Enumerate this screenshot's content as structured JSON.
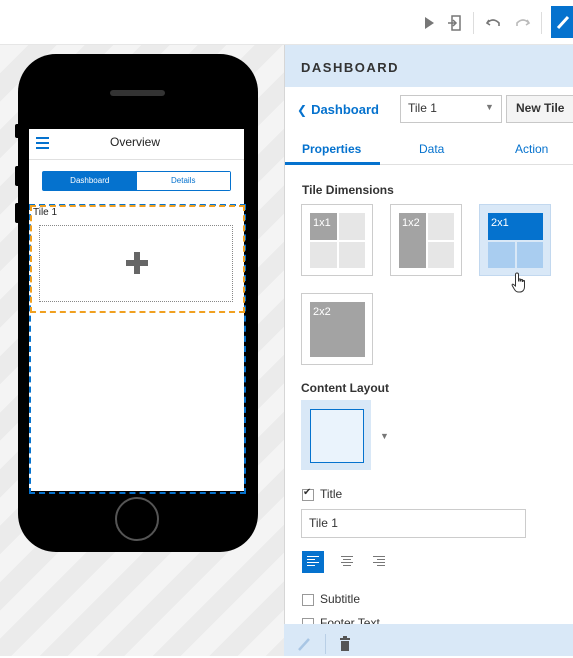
{
  "phone": {
    "header_title": "Overview",
    "tabs": [
      "Dashboard",
      "Details"
    ],
    "tile_label": "Tile 1"
  },
  "panel": {
    "header": "DASHBOARD",
    "back_link": "Dashboard",
    "tile_select_value": "Tile 1",
    "new_tile_label": "New Tile",
    "tabs": [
      "Properties",
      "Data",
      "Action"
    ],
    "tile_dimensions_label": "Tile Dimensions",
    "dimensions": [
      "1x1",
      "1x2",
      "2x1",
      "2x2"
    ],
    "selected_dimension": "2x1",
    "content_layout_label": "Content Layout",
    "title_checkbox_label": "Title",
    "title_value": "Tile 1",
    "subtitle_checkbox_label": "Subtitle",
    "footer_text_label": "Footer Text"
  },
  "colors": {
    "accent": "#0572ce",
    "panel_header": "#d9e8f7",
    "tile_outline": "#f0a020"
  }
}
